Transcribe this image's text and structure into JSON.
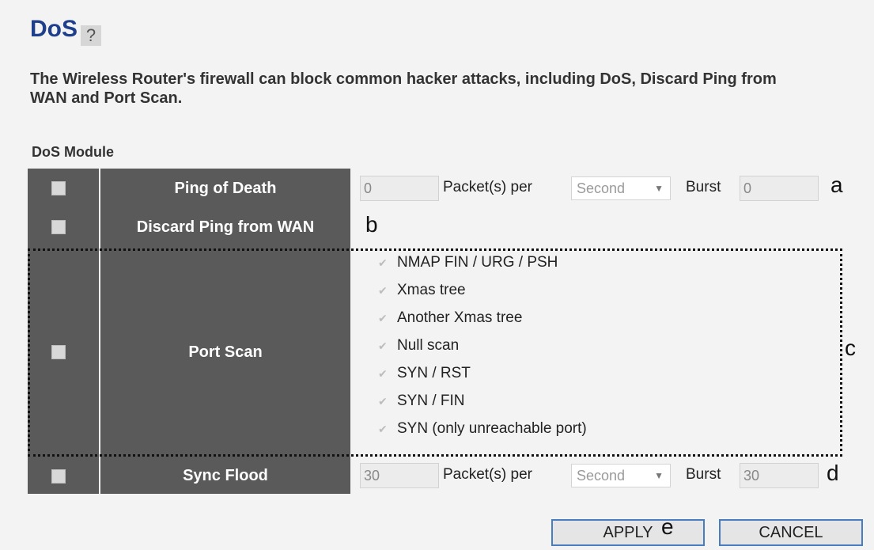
{
  "header": {
    "title": "DoS",
    "help_icon": "help-icon"
  },
  "description": "The Wireless Router's firewall can block common hacker attacks, including DoS, Discard Ping from WAN and Port Scan.",
  "module_label": "DoS Module",
  "rows": {
    "ping_of_death": {
      "label": "Ping of Death",
      "packets_value": "0",
      "packets_per_label": "Packet(s) per",
      "unit_selected": "Second",
      "burst_label": "Burst",
      "burst_value": "0",
      "annotation": "a"
    },
    "discard_ping": {
      "label": "Discard Ping from WAN",
      "annotation": "b"
    },
    "port_scan": {
      "label": "Port Scan",
      "options": [
        "NMAP FIN / URG / PSH",
        "Xmas tree",
        "Another Xmas tree",
        "Null scan",
        "SYN / RST",
        "SYN / FIN",
        "SYN (only unreachable port)"
      ],
      "annotation": "c"
    },
    "sync_flood": {
      "label": "Sync Flood",
      "packets_value": "30",
      "packets_per_label": "Packet(s) per",
      "unit_selected": "Second",
      "burst_label": "Burst",
      "burst_value": "30",
      "annotation": "d"
    }
  },
  "buttons": {
    "apply": "APPLY",
    "apply_annotation": "e",
    "cancel": "CANCEL"
  },
  "colors": {
    "header_cell": "#5a5a5a",
    "title": "#1f3f8c",
    "button_border": "#4a7dbf"
  }
}
